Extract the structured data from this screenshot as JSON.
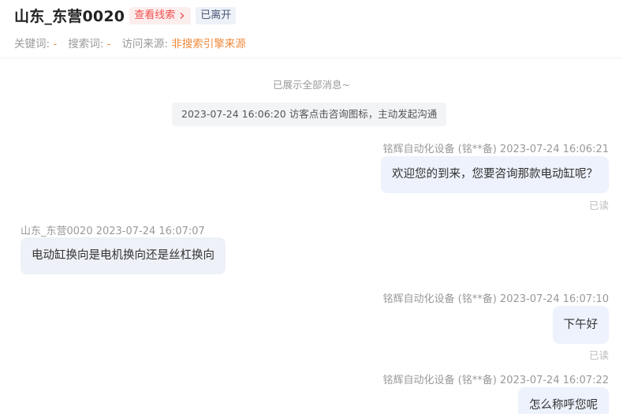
{
  "header": {
    "visitor_name": "山东_东营0020",
    "lead_link": "查看线索",
    "status": "已离开",
    "meta": [
      {
        "label": "关键词: ",
        "value": "-"
      },
      {
        "label": "搜索词: ",
        "value": "-"
      },
      {
        "label": "访问来源: ",
        "value": "非搜索引擎来源"
      }
    ]
  },
  "chat": {
    "notice": "已展示全部消息~",
    "event": "2023-07-24 16:06:20 访客点击咨询图标，主动发起沟通",
    "messages": [
      {
        "side": "right",
        "sender": "铭辉自动化设备 (铭**备) 2023-07-24 16:06:21",
        "text": "欢迎您的到来，您要咨询那款电动缸呢？",
        "status": "已读"
      },
      {
        "side": "left",
        "sender": "山东_东营0020 2023-07-24 16:07:07",
        "text": "电动缸换向是电机换向还是丝杠换向"
      },
      {
        "side": "right",
        "sender": "铭辉自动化设备 (铭**备) 2023-07-24 16:07:10",
        "text": "下午好",
        "status": "已读"
      },
      {
        "side": "right",
        "sender": "铭辉自动化设备 (铭**备) 2023-07-24 16:07:22",
        "text": "怎么称呼您呢"
      }
    ]
  },
  "colors": {
    "accent_red": "#f04f4f",
    "meta_orange": "#f08a3c",
    "bubble_bg": "#edf2fc"
  }
}
